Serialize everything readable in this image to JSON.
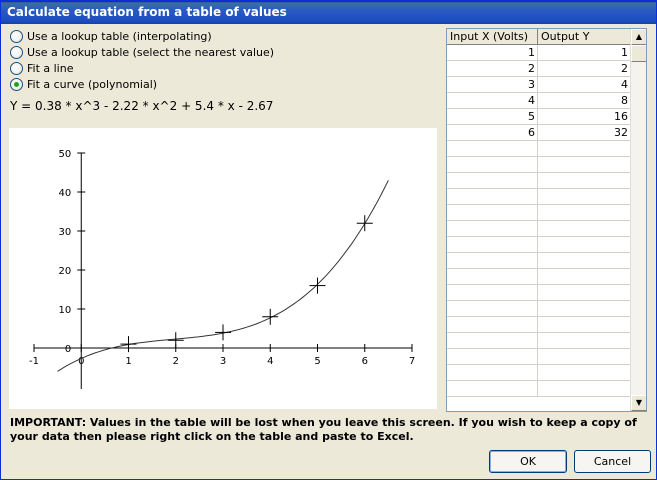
{
  "window": {
    "title": "Calculate equation from a table of values"
  },
  "options": [
    {
      "label": "Use a lookup table (interpolating)",
      "checked": false
    },
    {
      "label": "Use a lookup table (select the nearest value)",
      "checked": false
    },
    {
      "label": "Fit a line",
      "checked": false
    },
    {
      "label": "Fit a curve (polynomial)",
      "checked": true
    }
  ],
  "equation": "Y = 0.38 * x^3 - 2.22 * x^2 + 5.4 * x - 2.67",
  "table": {
    "headers": [
      "Input X (Volts)",
      "Output Y"
    ],
    "rows": [
      [
        "1",
        "1"
      ],
      [
        "2",
        "2"
      ],
      [
        "3",
        "4"
      ],
      [
        "4",
        "8"
      ],
      [
        "5",
        "16"
      ],
      [
        "6",
        "32"
      ]
    ],
    "empty_rows": 16
  },
  "chart_data": {
    "type": "scatter",
    "x": [
      1,
      2,
      3,
      4,
      5,
      6
    ],
    "y": [
      1,
      2,
      4,
      8,
      16,
      32
    ],
    "xlim": [
      -1,
      7
    ],
    "ylim": [
      -8,
      50
    ],
    "x_ticks": [
      -1,
      0,
      1,
      2,
      3,
      4,
      5,
      6,
      7
    ],
    "y_ticks": [
      0,
      10,
      20,
      30,
      40,
      50
    ],
    "curve": {
      "coefficients": [
        0.38,
        -2.22,
        5.4,
        -2.67
      ],
      "x_range": [
        -0.5,
        6.5
      ]
    },
    "marker": "plus",
    "grid": false,
    "title": "",
    "xlabel": "",
    "ylabel": ""
  },
  "notice": "IMPORTANT: Values in the table will be lost when you leave this screen. If you wish to keep a copy of your data then please right click on the table and paste to Excel.",
  "buttons": {
    "ok": "OK",
    "cancel": "Cancel"
  },
  "scroll_up_glyph": "▲",
  "scroll_down_glyph": "▼"
}
